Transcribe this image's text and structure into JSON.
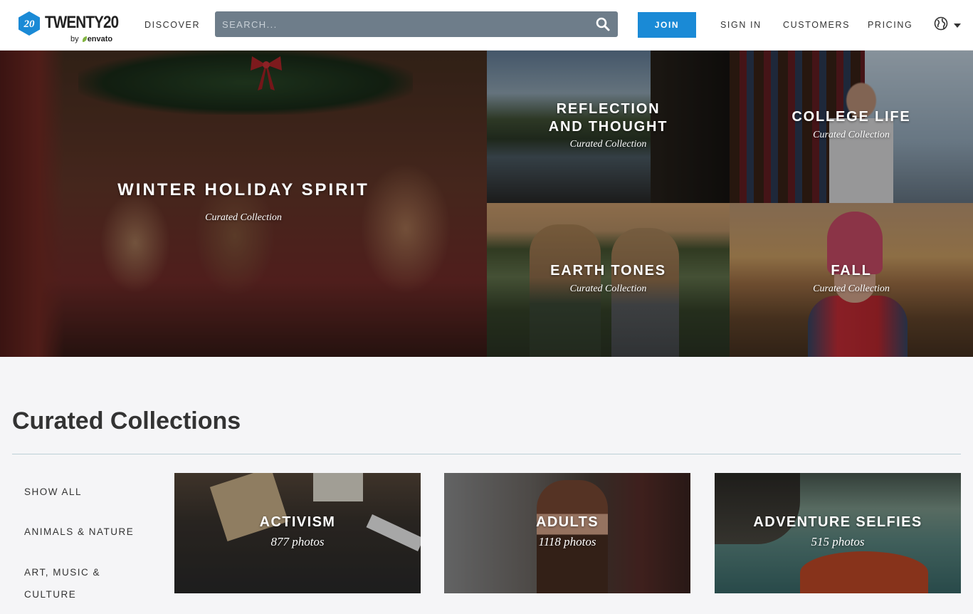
{
  "header": {
    "logo_word": "TWENTY20",
    "logo_by": "by",
    "logo_brand": "envato",
    "logo_badge": "20",
    "nav_discover": "DISCOVER",
    "search_placeholder": "SEARCH...",
    "join_label": "JOIN",
    "nav_signin": "SIGN IN",
    "nav_customers": "CUSTOMERS",
    "nav_pricing": "PRICING",
    "icons": {
      "search": "search-icon",
      "language": "globe-icon",
      "dropdown": "chevron-down-icon"
    },
    "accent_color": "#1a8ad6"
  },
  "hero": {
    "tiles": [
      {
        "title": "WINTER HOLIDAY SPIRIT",
        "subtitle": "Curated Collection"
      },
      {
        "title": "REFLECTION AND THOUGHT",
        "subtitle": "Curated Collection"
      },
      {
        "title": "COLLEGE LIFE",
        "subtitle": "Curated Collection"
      },
      {
        "title": "EARTH TONES",
        "subtitle": "Curated Collection"
      },
      {
        "title": "FALL",
        "subtitle": "Curated Collection"
      }
    ]
  },
  "curated": {
    "heading": "Curated Collections",
    "categories": [
      "SHOW ALL",
      "ANIMALS & NATURE",
      "ART, MUSIC & CULTURE"
    ],
    "cards": [
      {
        "title": "ACTIVISM",
        "count": "877 photos"
      },
      {
        "title": "ADULTS",
        "count": "1118 photos"
      },
      {
        "title": "ADVENTURE SELFIES",
        "count": "515 photos"
      }
    ]
  }
}
